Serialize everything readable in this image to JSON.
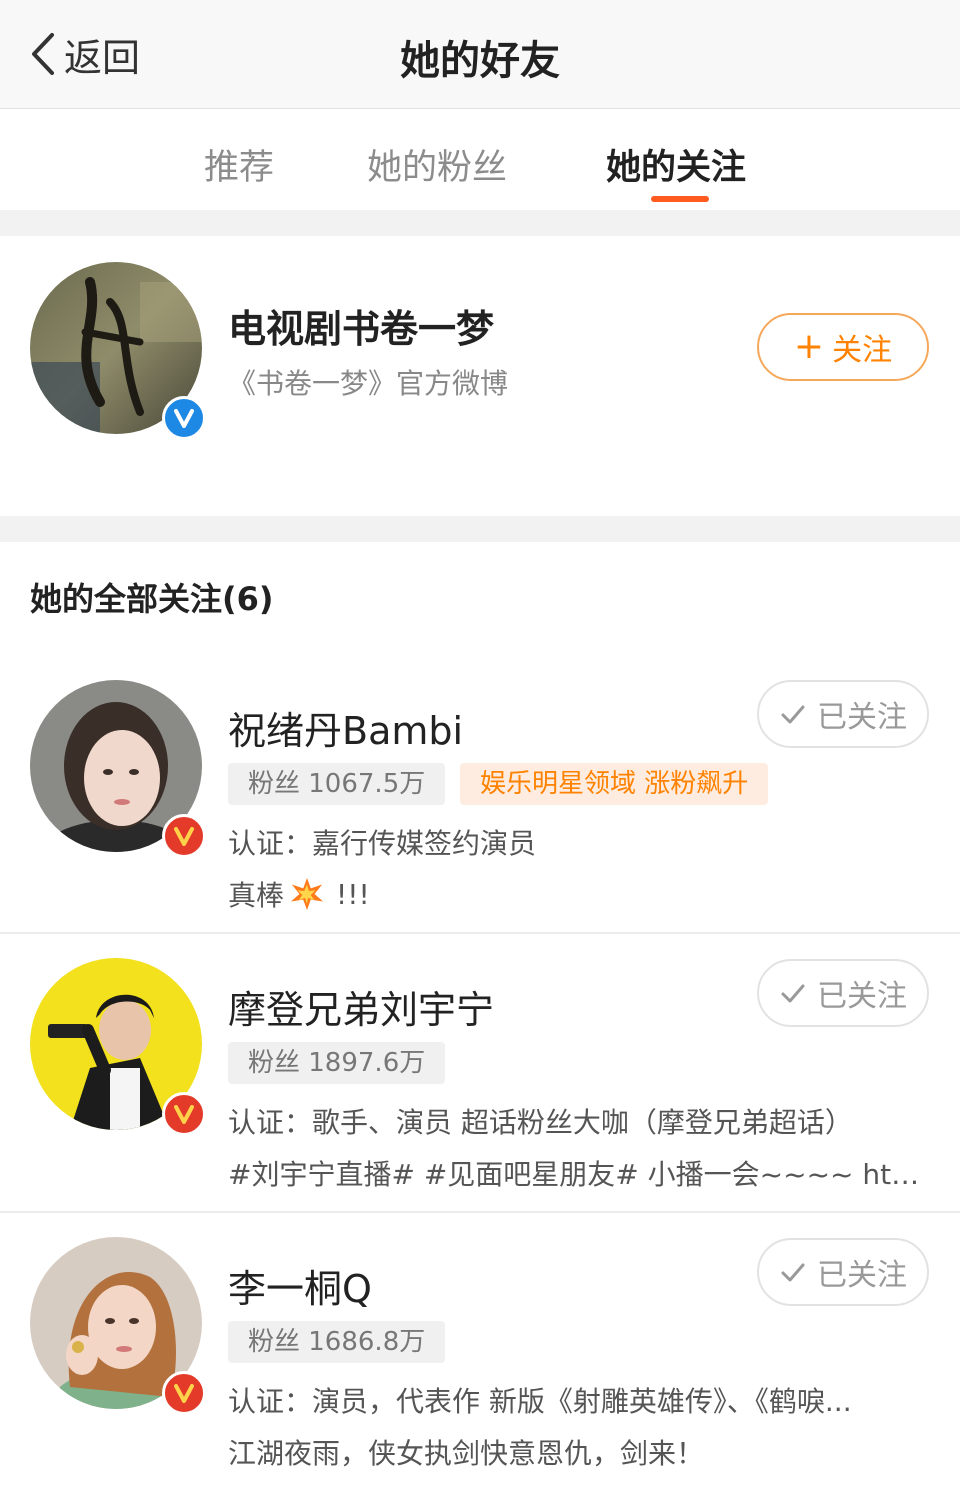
{
  "nav": {
    "back_label": "返回",
    "title": "她的好友"
  },
  "tabs": [
    {
      "label": "推荐",
      "active": false
    },
    {
      "label": "她的粉丝",
      "active": false
    },
    {
      "label": "她的关注",
      "active": true
    }
  ],
  "accent_color": "#ff8200",
  "tab_indicator_color": "#ff5a1f",
  "featured": {
    "name": "电视剧书卷一梦",
    "desc": "《书卷一梦》官方微博",
    "verified": "blue-v",
    "follow_label": "关注",
    "avatar_art_text": "书卷一梦"
  },
  "section": {
    "title": "她的全部关注(6)"
  },
  "users": [
    {
      "name": "祝绪丹Bambi",
      "fans": "粉丝 1067.5万",
      "tag": "娱乐明星领域 涨粉飙升",
      "verify": "认证：嘉行传媒签约演员",
      "bio": "真棒",
      "bio_suffix": "!!!",
      "button": "已关注",
      "verified": "gold-v"
    },
    {
      "name": "摩登兄弟刘宇宁",
      "fans": "粉丝 1897.6万",
      "verify": "认证：歌手、演员 超话粉丝大咖（摩登兄弟超话）",
      "bio": "#刘宇宁直播# #见面吧星朋友# 小播一会~~~~ htt...",
      "button": "已关注",
      "verified": "gold-v"
    },
    {
      "name": "李一桐Q",
      "fans": "粉丝 1686.8万",
      "verify": "认证：演员，代表作 新版《射雕英雄传》、《鹤唳...",
      "bio": "江湖夜雨，侠女执剑快意恩仇，剑来！",
      "button": "已关注",
      "verified": "gold-v"
    }
  ]
}
